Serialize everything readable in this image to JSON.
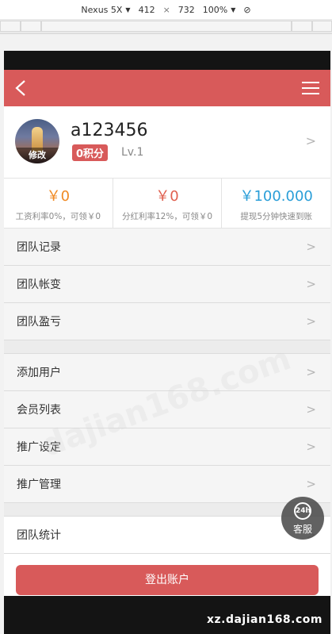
{
  "devtools": {
    "device": "Nexus 5X",
    "width": "412",
    "times": "×",
    "height": "732",
    "zoom": "100%"
  },
  "app": {
    "username": "a123456",
    "points_badge": "0积分",
    "level": "Lv.1",
    "avatar_edit": "修改",
    "chevron": ">"
  },
  "stats": [
    {
      "value": "￥0",
      "label": "工资利率0%，可领￥0"
    },
    {
      "value": "￥0",
      "label": "分红利率12%，可领￥0"
    },
    {
      "value": "￥100.000",
      "label": "提现5分钟快速到账"
    }
  ],
  "menu_group1": [
    "团队记录",
    "团队帐变",
    "团队盈亏"
  ],
  "menu_group2": [
    "添加用户",
    "会员列表",
    "推广设定",
    "推广管理"
  ],
  "menu_group3": [
    "团队统计"
  ],
  "logout": "登出账户",
  "service": {
    "hours": "24h",
    "label": "客服"
  },
  "watermark": "dajian168.com",
  "site_url": "xz.dajian168.com",
  "colors": {
    "primary": "#d85a5a",
    "orange": "#f08a24",
    "blue": "#2a9ed8"
  }
}
